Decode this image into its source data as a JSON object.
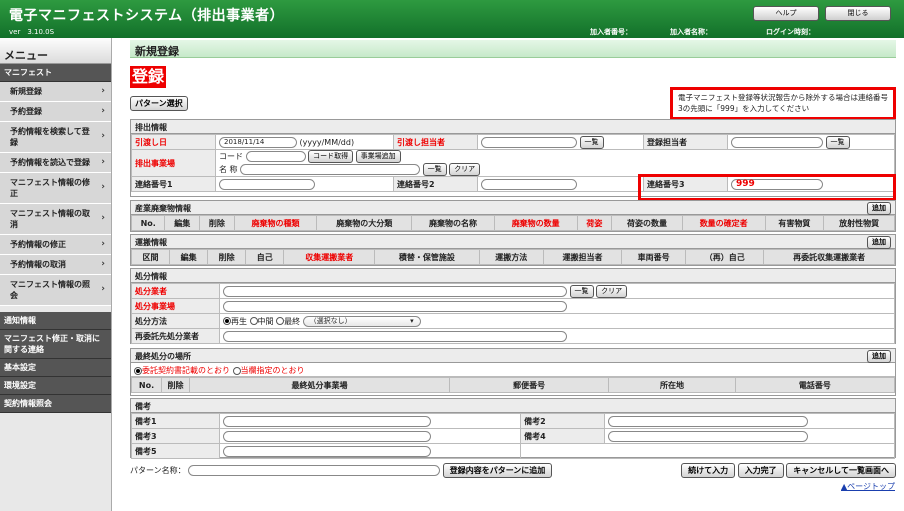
{
  "header": {
    "title": "電子マニフェストシステム（排出事業者）",
    "version": "ver　3.10.0S",
    "subscriber_label": "加入者番号：",
    "subscriber_name_label": "加入者名称：",
    "login_label": "ログイン時刻：",
    "help_button": "ヘルプ",
    "close_button": "閉じる"
  },
  "sidebar": {
    "menu_title": "メニュー",
    "manifest_section": "マニフェスト",
    "items": [
      "新規登録",
      "予約登録",
      "予約情報を検索して登録",
      "予約情報を読込で登録",
      "マニフェスト情報の修正",
      "マニフェスト情報の取消",
      "予約情報の修正",
      "予約情報の取消",
      "マニフェスト情報の照会"
    ],
    "sections": [
      "通知情報",
      "マニフェスト修正・取消に関する連絡",
      "基本設定",
      "環境設定",
      "契約情報照会"
    ]
  },
  "page": {
    "breadcrumb": "新規登録",
    "title": "登録",
    "pattern_select": "パターン選択",
    "notice": "電子マニフェスト登録等状況報告から除外する場合は連絡番号3の先頭に「999」を入力してください"
  },
  "discharge": {
    "title": "排出情報",
    "delivery_date_label": "引渡し日",
    "delivery_date_value": "2018/11/14",
    "date_format": "(yyyy/MM/dd)",
    "handler_label": "引渡し担当者",
    "list_button": "一覧",
    "registrant_label": "登録担当者",
    "site_label": "排出事業場",
    "code_label": "コード",
    "code_get_button": "コード取得",
    "site_add_button": "事業場追加",
    "name_label": "名 称",
    "clear_button": "クリア",
    "contact1_label": "連絡番号1",
    "contact2_label": "連絡番号2",
    "contact3_label": "連絡番号3",
    "contact3_value": "999"
  },
  "waste": {
    "title": "産業廃棄物情報",
    "add_button": "追加",
    "columns": [
      "No.",
      "編集",
      "削除",
      "廃棄物の種類",
      "廃棄物の大分類",
      "廃棄物の名称",
      "廃棄物の数量",
      "荷姿",
      "荷姿の数量",
      "数量の確定者",
      "有害物質",
      "放射性物質"
    ]
  },
  "transport": {
    "title": "運搬情報",
    "add_button": "追加",
    "columns": [
      "区間",
      "編集",
      "削除",
      "自己",
      "収集運搬業者",
      "積替・保管施設",
      "運搬方法",
      "運搬担当者",
      "車両番号",
      "（再）自己",
      "再委託収集運搬業者"
    ]
  },
  "disposal": {
    "title": "処分情報",
    "company_label": "処分業者",
    "site_label": "処分事業場",
    "method_label": "処分方法",
    "method_options": [
      "再生",
      "中間",
      "最終"
    ],
    "method_select": "（選択なし）",
    "subcontract_label": "再委託先処分業者",
    "list_button": "一覧",
    "clear_button": "クリア"
  },
  "final": {
    "title": "最終処分の場所",
    "add_button": "追加",
    "option1": "委託契約書記載のとおり",
    "option2": "当欄指定のとおり",
    "columns": [
      "No.",
      "削除",
      "最終処分事業場",
      "郵便番号",
      "所在地",
      "電話番号"
    ]
  },
  "remarks": {
    "title": "備考",
    "labels": [
      "備考1",
      "備考2",
      "備考3",
      "備考4",
      "備考5"
    ]
  },
  "footer": {
    "pattern_name_label": "パターン名称：",
    "save_pattern_button": "登録内容をパターンに追加",
    "continue_button": "続けて入力",
    "complete_button": "入力完了",
    "cancel_button": "キャンセルして一覧画面へ",
    "page_top": "▲ページトップ"
  }
}
